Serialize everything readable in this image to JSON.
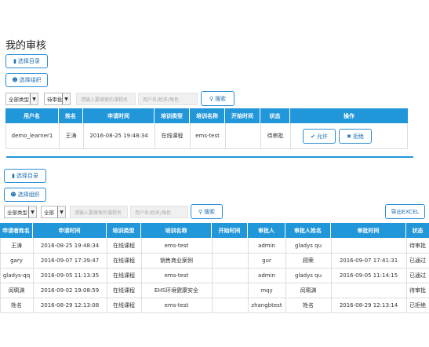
{
  "page_title": "我的审核",
  "section1": {
    "btn_select_catalog": "选择目录",
    "btn_select_org": "选择组织",
    "filter_type": "全部类型",
    "filter_status": "待审批",
    "course_placeholder": "请输入要搜索的课程名",
    "user_placeholder": "用户名/姓名/角色",
    "search_label": "搜索",
    "headers": [
      "用户名",
      "姓名",
      "申请时间",
      "培训类型",
      "培训名称",
      "开始时间",
      "状态",
      "操作"
    ],
    "rows": [
      {
        "username": "demo_learner1",
        "name": "王涛",
        "time": "2016-08-25 19:48:34",
        "type": "在线课程",
        "training": "ems-test",
        "start": "",
        "status": "待审批",
        "allow": "允许",
        "reject": "拒绝"
      }
    ]
  },
  "section2": {
    "btn_select_catalog": "选择目录",
    "btn_select_org": "选择组织",
    "filter_type": "全部类型",
    "filter_all": "全部",
    "course_placeholder": "请输入要搜索的课程名",
    "user_placeholder": "用户名/姓名/角色",
    "search_label": "搜索",
    "export_label": "导出EXCEL",
    "headers": [
      "申请者姓名",
      "申请时间",
      "培训类型",
      "培训名称",
      "开始时间",
      "审批人",
      "审批人姓名",
      "审批时间",
      "状态"
    ],
    "rows": [
      [
        "王涛",
        "2016-08-25 19:48:34",
        "在线课程",
        "ems-test",
        "",
        "admin",
        "gladys qu",
        "",
        "待审批"
      ],
      [
        "gary",
        "2016-09-07 17:39:47",
        "在线课程",
        "销售商业案例",
        "",
        "gur",
        "顾荣",
        "2016-09-07 17:41:31",
        "已通过"
      ],
      [
        "gladys-qq",
        "2016-09-05 11:13:35",
        "在线课程",
        "ems-test",
        "",
        "admin",
        "gladys qu",
        "2016-09-05 11:14:15",
        "已通过"
      ],
      [
        "闵珮渊",
        "2016-09-02 19:08:59",
        "在线课程",
        "EHS环境健康安全",
        "",
        "mqy",
        "闵珮渊",
        "",
        "待审批"
      ],
      [
        "姓名",
        "2016-08-29 12:13:08",
        "在线课程",
        "ems-test",
        "",
        "zhangbtest",
        "姓名",
        "2016-08-29 12:13:14",
        "已拒绝"
      ]
    ]
  },
  "colors": {
    "header_blue": "#2196d9",
    "button_border": "#2a8fd4"
  }
}
